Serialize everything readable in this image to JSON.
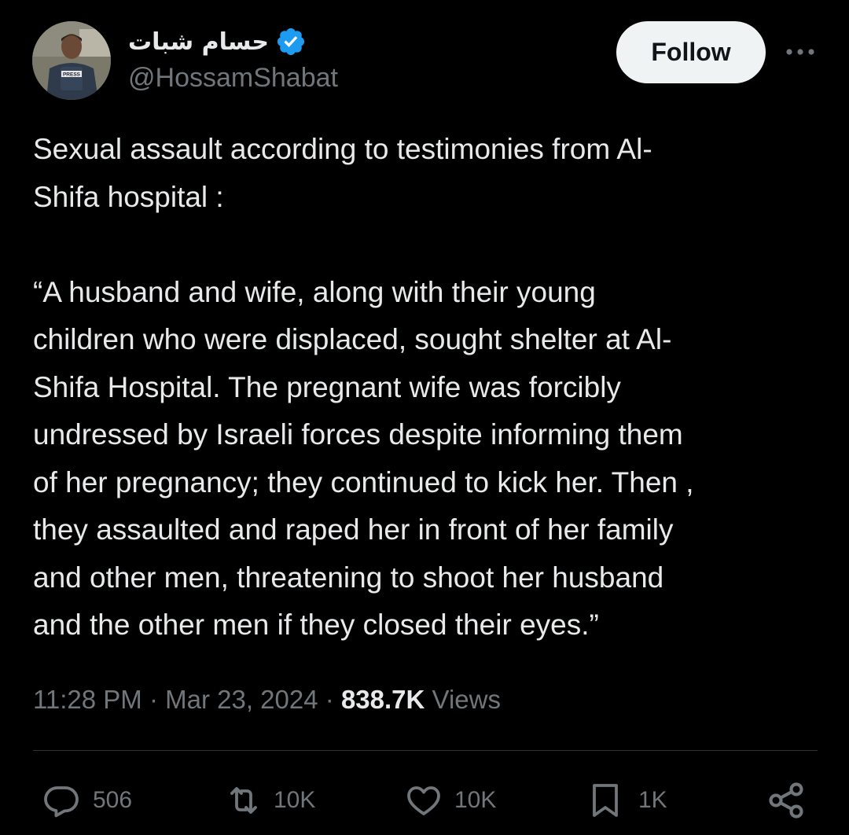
{
  "author": {
    "display_name": "حسام شبات",
    "handle": "@HossamShabat",
    "avatar_badge_text": "PRESS",
    "verified": true
  },
  "header": {
    "follow_label": "Follow"
  },
  "tweet": {
    "text": "Sexual assault according to testimonies from Al-\nShifa hospital :\n\n“A husband and wife, along with their young\nchildren who were displaced, sought shelter at Al-\nShifa Hospital. The pregnant wife was forcibly\nundressed by Israeli forces despite informing them\nof her pregnancy; they continued to kick her. Then ,\nthey assaulted and raped her in front of her family\nand other men, threatening to shoot her husband\nand the other men if they closed their eyes.”",
    "time": "11:28 PM",
    "date": "Mar 23, 2024",
    "separator": " · ",
    "views_count": "838.7K",
    "views_label": " Views"
  },
  "actions": {
    "replies": "506",
    "reposts": "10K",
    "likes": "10K",
    "bookmarks": "1K"
  },
  "icons": {
    "verified": "verified-badge-icon",
    "more": "more-options-icon",
    "reply": "reply-icon",
    "repost": "repost-icon",
    "like": "heart-icon",
    "bookmark": "bookmark-icon",
    "share": "share-icon"
  },
  "colors": {
    "background": "#000000",
    "text_primary": "#e7e9ea",
    "text_secondary": "#71767b",
    "verified_blue": "#1d9bf0",
    "follow_button_bg": "#eff3f4",
    "divider": "#2f3336"
  }
}
